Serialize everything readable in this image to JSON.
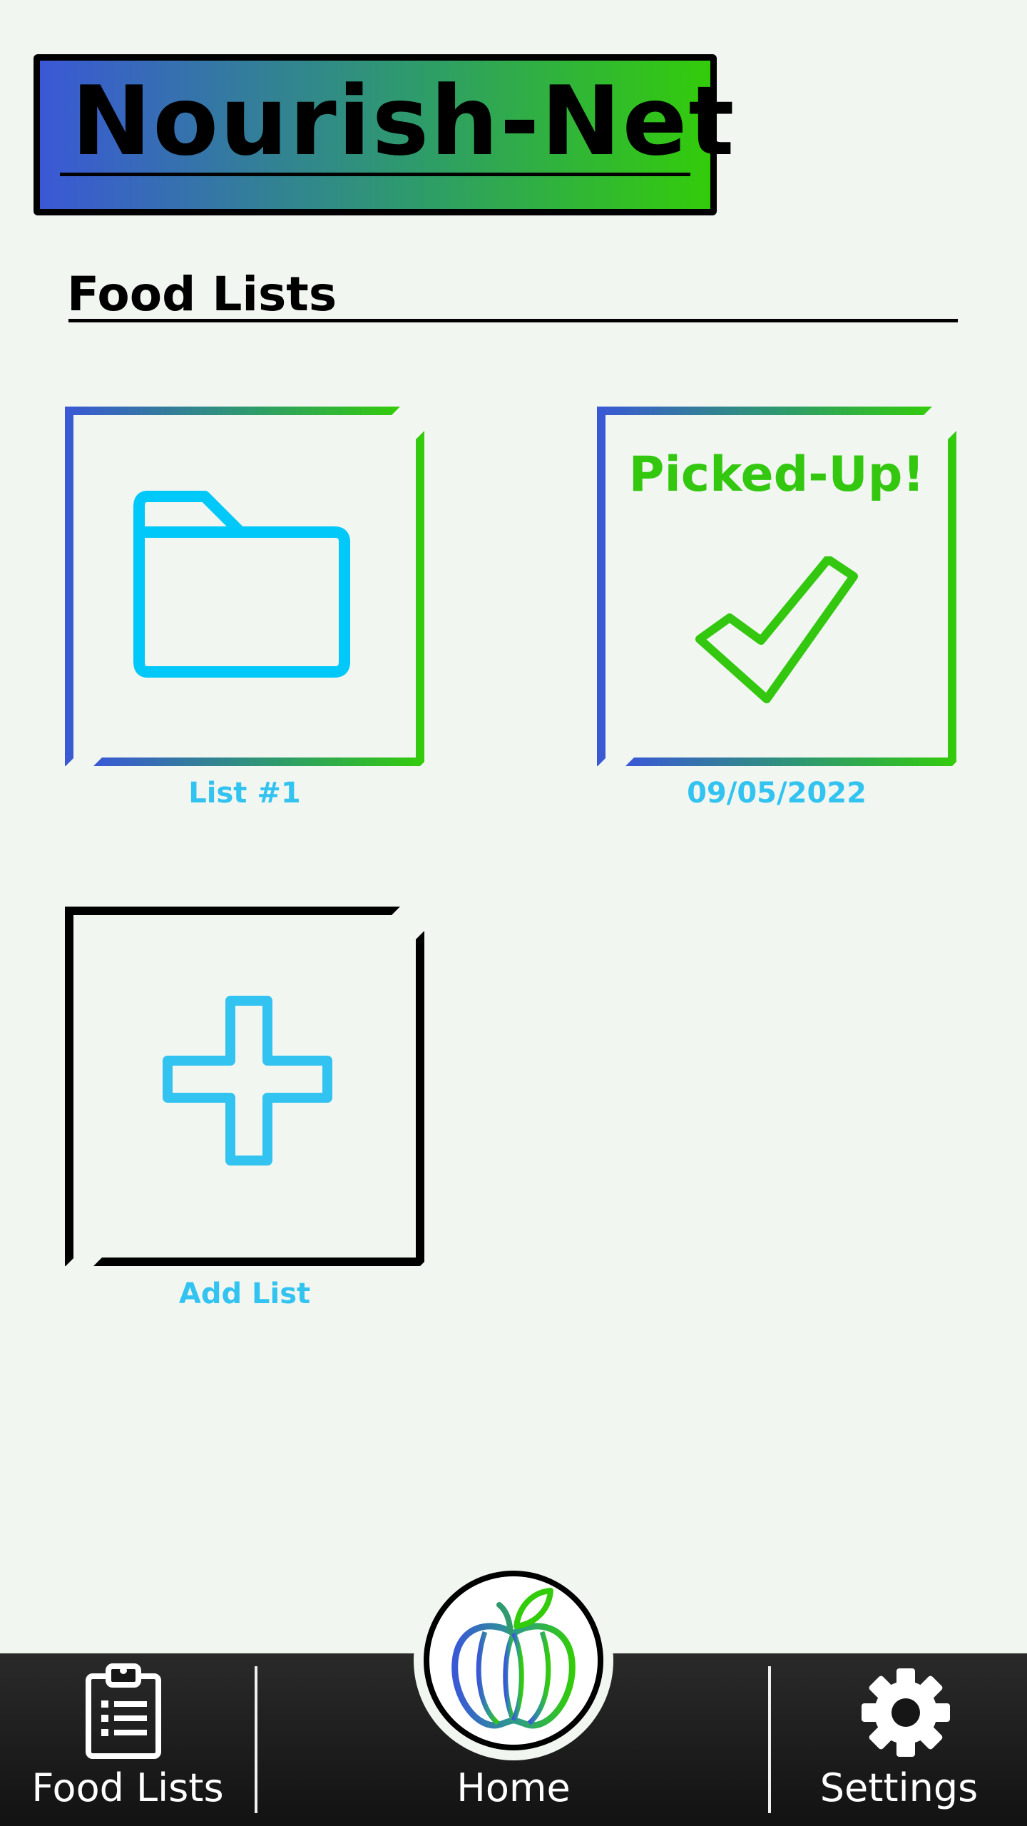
{
  "header": {
    "logo_text": "Nourish-Net"
  },
  "section": {
    "title": "Food Lists"
  },
  "tiles": [
    {
      "caption": "List #1",
      "icon": "folder-icon"
    },
    {
      "caption": "09/05/2022",
      "badge": "Picked-Up!",
      "icon": "checkmark-icon"
    },
    {
      "caption": "Add List",
      "icon": "plus-icon"
    }
  ],
  "nav": {
    "items": [
      {
        "label": "Food Lists",
        "icon": "clipboard-list-icon"
      },
      {
        "label": "Home",
        "icon": "apple-globe-icon"
      },
      {
        "label": "Settings",
        "icon": "gear-icon"
      }
    ]
  },
  "colors": {
    "brand_blue": "#3a58d6",
    "brand_green": "#33cc0a",
    "accent_cyan": "#33c3f0",
    "background": "#f1f6f1",
    "nav_background": "#161616"
  }
}
